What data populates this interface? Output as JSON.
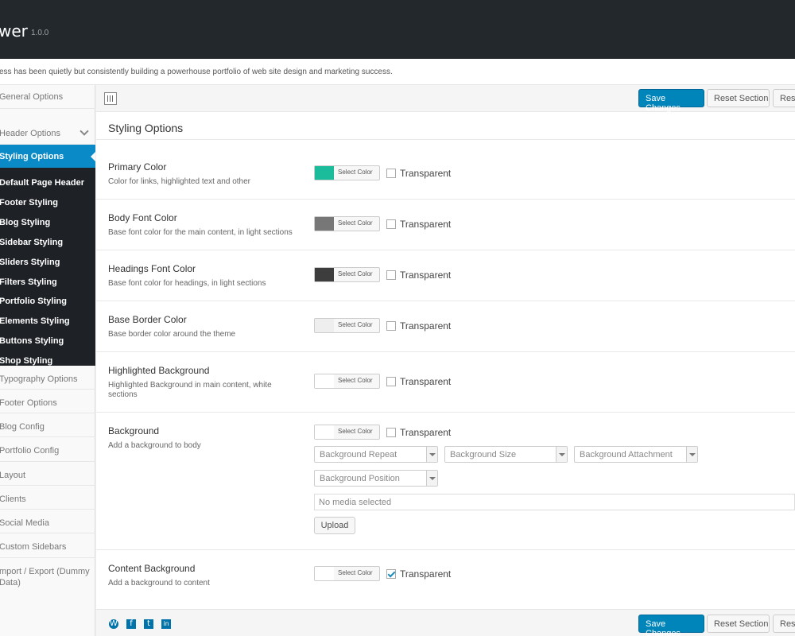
{
  "header": {
    "title": "wer",
    "version": "1.0.0"
  },
  "tagline": "ess has been quietly but consistently building a powerhouse portfolio of web site design and marketing success.",
  "sidebar": {
    "items_top": [
      {
        "label": "General Options"
      },
      {
        "label": "Header Options"
      }
    ],
    "active": "Styling Options",
    "sub_items": [
      "Default Page Header",
      "Footer Styling",
      "Blog Styling",
      "Sidebar Styling",
      "Sliders Styling",
      "Filters Styling",
      "Portfolio Styling",
      "Elements Styling",
      "Buttons Styling",
      "Shop Styling"
    ],
    "items_bottom": [
      "Typography Options",
      "Footer Options",
      "Blog Config",
      "Portfolio Config",
      "Layout",
      "Clients",
      "Social Media",
      "Custom Sidebars",
      "mport / Export (Dummy",
      "Data)"
    ]
  },
  "toolbar": {
    "save_label": "Save Changes",
    "reset_section_label": "Reset Section",
    "reset_all_label": "Rese"
  },
  "section_title": "Styling Options",
  "rows": [
    {
      "label": "Primary Color",
      "desc": "Color for links, highlighted text and other",
      "swatch": "#1abc9c",
      "picker": "Select Color",
      "check": "Transparent",
      "checked": false
    },
    {
      "label": "Body Font Color",
      "desc": "Base font color for the main content, in light sections",
      "swatch": "#777777",
      "picker": "Select Color",
      "check": "Transparent",
      "checked": false
    },
    {
      "label": "Headings Font Color",
      "desc": "Base font color for headings, in light sections",
      "swatch": "#3d3d3d",
      "picker": "Select Color",
      "check": "Transparent",
      "checked": false
    },
    {
      "label": "Base Border Color",
      "desc": "Base border color around the theme",
      "swatch": "#eeeeee",
      "picker": "Select Color",
      "check": "Transparent",
      "checked": false
    },
    {
      "label": "Highlighted Background",
      "desc": "Highlighted Background in main content, white sections",
      "swatch": "#ffffff",
      "picker": "Select Color",
      "check": "Transparent",
      "checked": false
    },
    {
      "label": "Background",
      "desc": "Add a background to body",
      "swatch": "#ffffff",
      "picker": "Select Color",
      "check": "Transparent",
      "checked": false
    },
    {
      "label": "Content Background",
      "desc": "Add a background to content",
      "swatch": "#ffffff",
      "picker": "Select Color",
      "check": "Transparent",
      "checked": true
    }
  ],
  "background": {
    "repeat": "Background Repeat",
    "size": "Background Size",
    "attachment": "Background Attachment",
    "position": "Background Position",
    "media": "No media selected",
    "upload": "Upload"
  },
  "social_icons": [
    {
      "name": "wordpress-icon",
      "glyph": "W",
      "color": "#0073aa"
    },
    {
      "name": "facebook-icon",
      "glyph": "f",
      "color": "#0073aa"
    },
    {
      "name": "twitter-icon",
      "glyph": "t",
      "color": "#0073aa"
    },
    {
      "name": "linkedin-icon",
      "glyph": "in",
      "color": "#0073aa"
    }
  ]
}
